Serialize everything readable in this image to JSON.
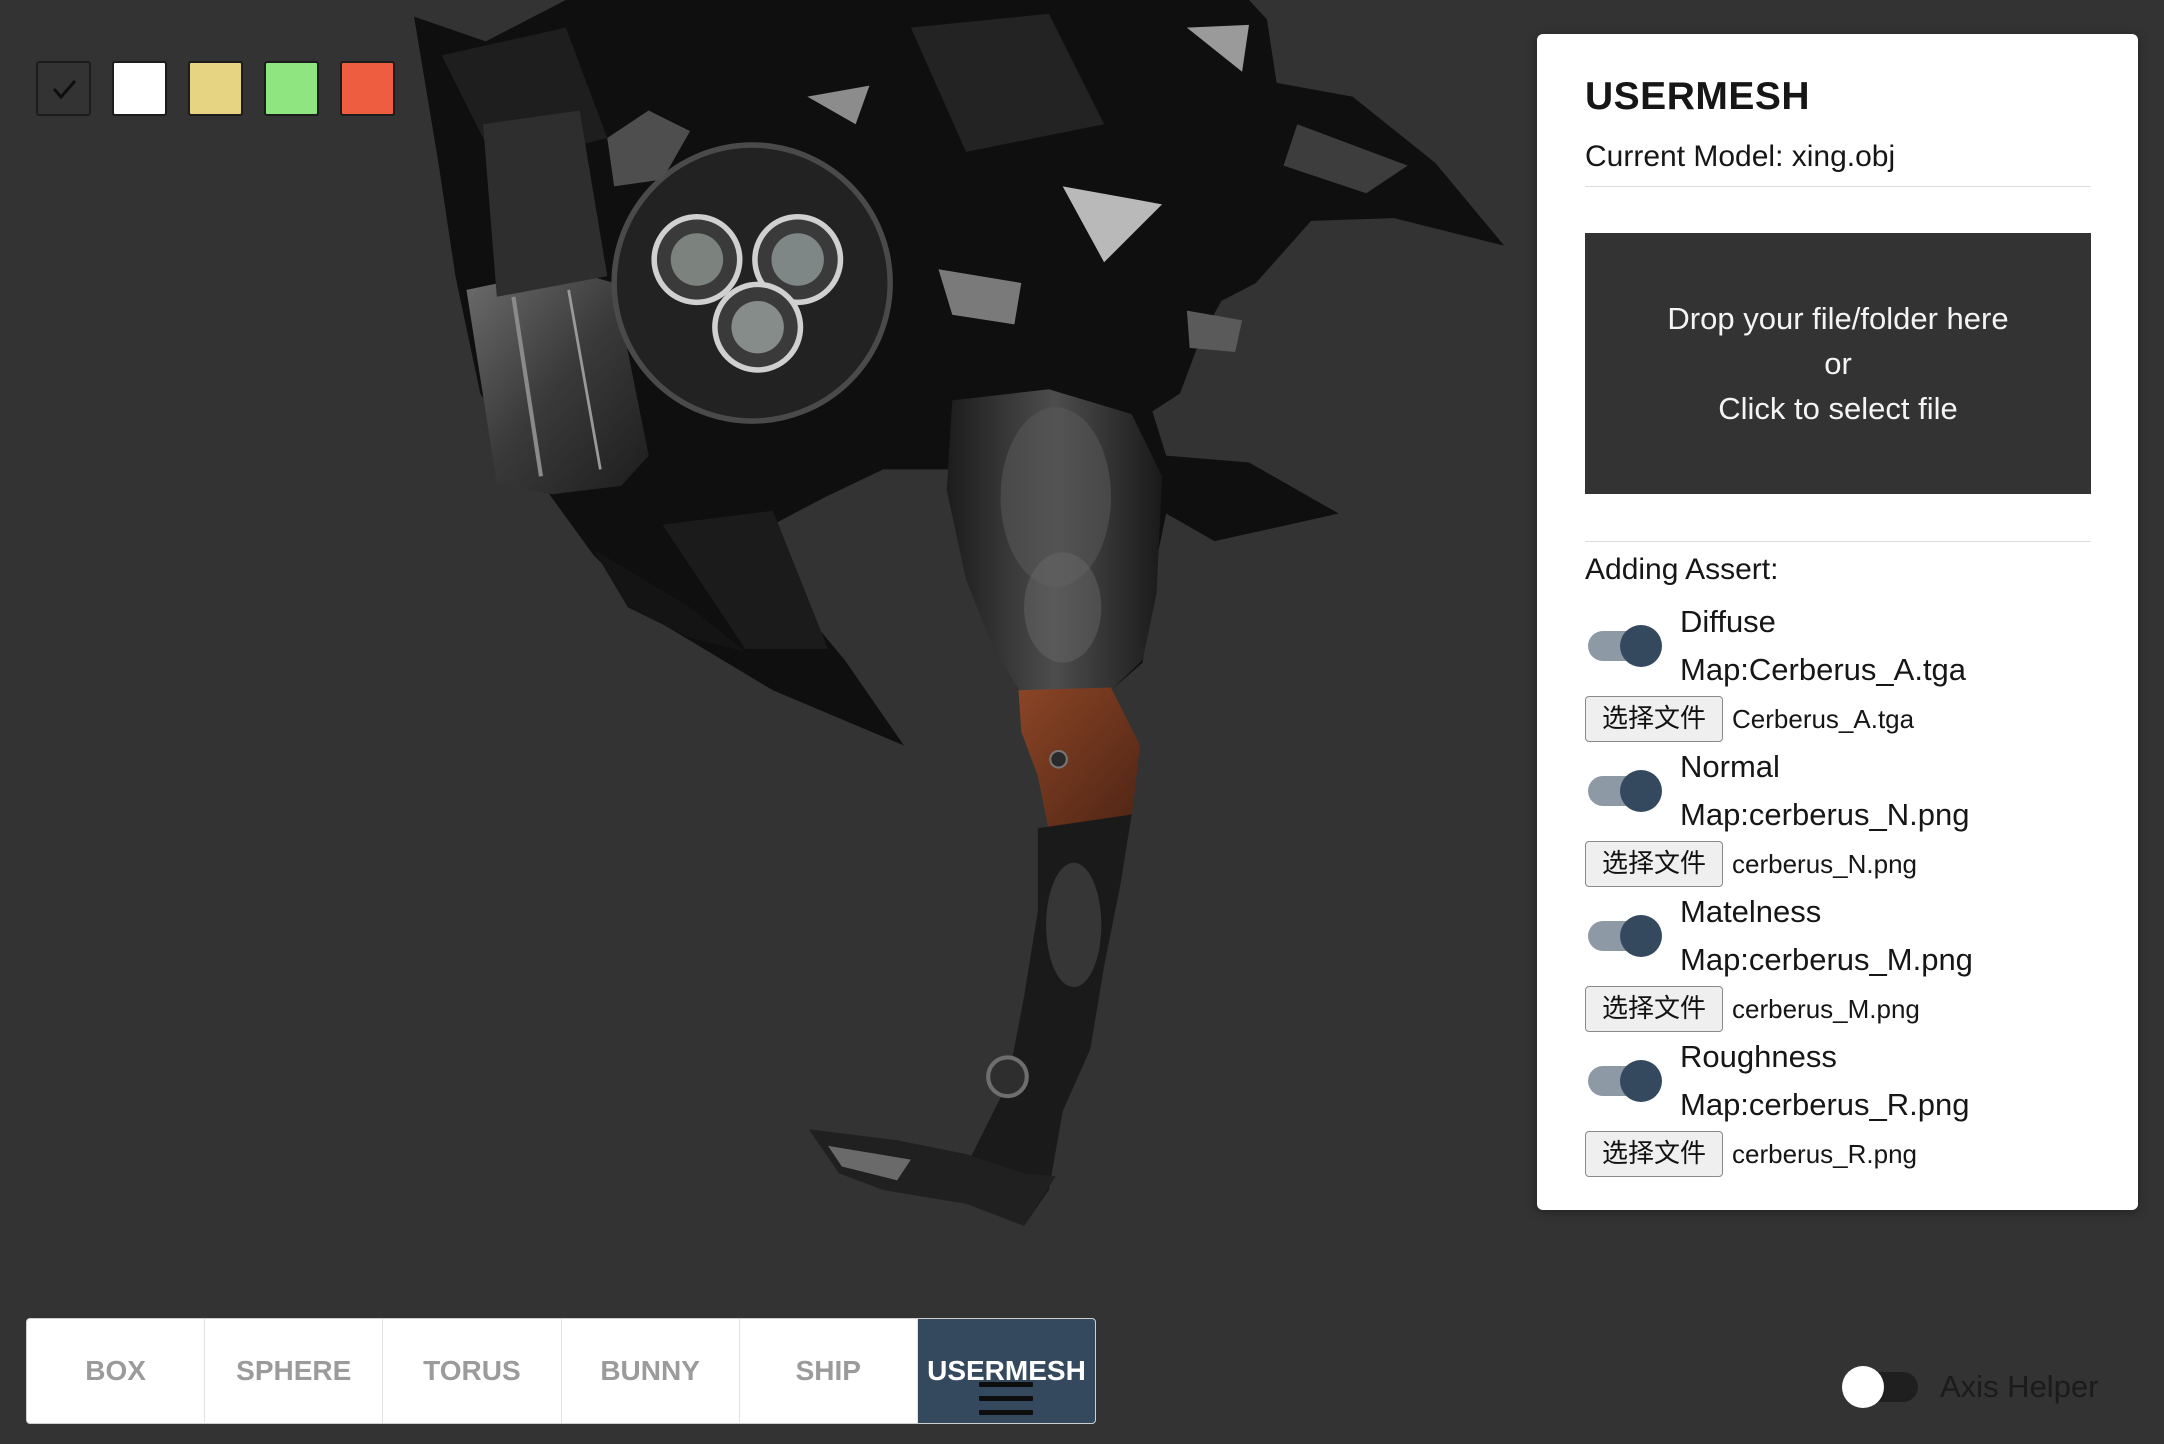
{
  "colors": {
    "viewport_background": "#333333",
    "accent": "#34495e"
  },
  "swatches": [
    {
      "color": "#333333",
      "selected": true
    },
    {
      "color": "#ffffff",
      "selected": false
    },
    {
      "color": "#e6d483",
      "selected": false
    },
    {
      "color": "#8fe57f",
      "selected": false
    },
    {
      "color": "#ee5d3f",
      "selected": false
    }
  ],
  "panel": {
    "title": "USERMESH",
    "current_model": "Current Model: xing.obj",
    "dropzone": {
      "line1": "Drop your file/folder here",
      "line2": "or",
      "line3": "Click to select file"
    },
    "assets_heading": "Adding Assert:",
    "assets": [
      {
        "type": "Diffuse",
        "map": "Map:Cerberus_A.tga",
        "enabled": true,
        "button_label": "选择文件",
        "file_name": "Cerberus_A.tga"
      },
      {
        "type": "Normal",
        "map": "Map:cerberus_N.png",
        "enabled": true,
        "button_label": "选择文件",
        "file_name": "cerberus_N.png"
      },
      {
        "type": "Matelness",
        "map": "Map:cerberus_M.png",
        "enabled": true,
        "button_label": "选择文件",
        "file_name": "cerberus_M.png"
      },
      {
        "type": "Roughness",
        "map": "Map:cerberus_R.png",
        "enabled": true,
        "button_label": "选择文件",
        "file_name": "cerberus_R.png"
      }
    ]
  },
  "tabs": {
    "items": [
      {
        "label": "BOX"
      },
      {
        "label": "SPHERE"
      },
      {
        "label": "TORUS"
      },
      {
        "label": "BUNNY"
      },
      {
        "label": "SHIP"
      },
      {
        "label": "USERMESH"
      }
    ],
    "active": "USERMESH"
  },
  "axis_helper": {
    "label": "Axis Helper",
    "enabled": false
  },
  "icons": {
    "selected_swatch": "check-icon",
    "menu": "hamburger-icon"
  }
}
